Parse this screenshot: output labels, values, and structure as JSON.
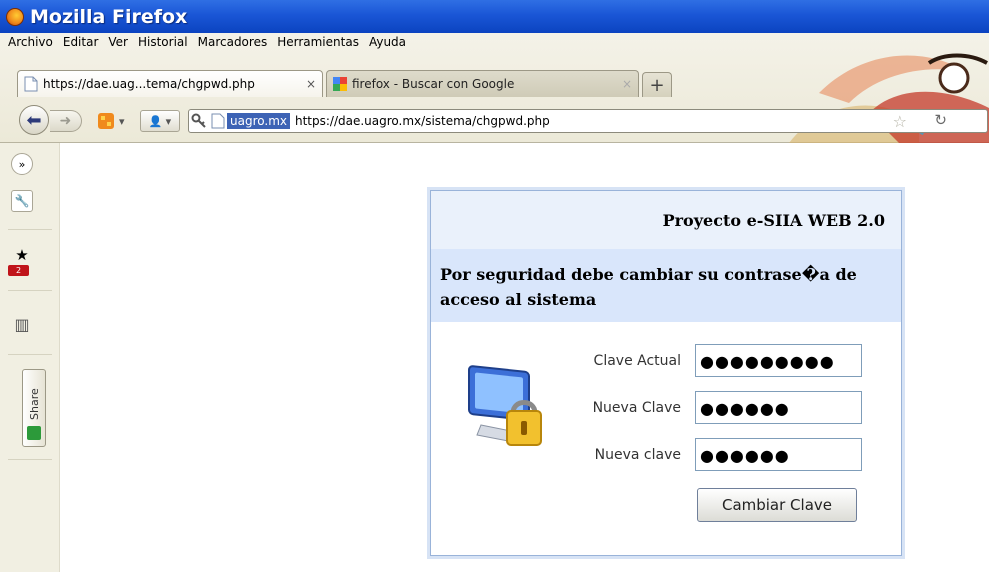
{
  "window": {
    "title": "Mozilla Firefox"
  },
  "menu": [
    "Archivo",
    "Editar",
    "Ver",
    "Historial",
    "Marcadores",
    "Herramientas",
    "Ayuda"
  ],
  "tabs": [
    {
      "label": "https://dae.uag...tema/chgpwd.php",
      "close": "×"
    },
    {
      "label": "firefox - Buscar con Google",
      "close": "×"
    }
  ],
  "new_tab": "+",
  "navbar": {
    "domain_badge": "uagro.mx",
    "url": "https://dae.uagro.mx/sistema/chgpwd.php"
  },
  "sidebar": {
    "badge_count": "2",
    "share_label": "Share"
  },
  "form": {
    "title": "Proyecto e-SIIA WEB 2.0",
    "message": "Por seguridad debe cambiar su contrase�a de acceso al sistema",
    "fields": [
      {
        "label": "Clave Actual",
        "masked": "●●●●●●●●●"
      },
      {
        "label": "Nueva Clave",
        "masked": "●●●●●●"
      },
      {
        "label": "Nueva clave",
        "masked": "●●●●●●"
      }
    ],
    "submit_label": "Cambiar Clave"
  }
}
